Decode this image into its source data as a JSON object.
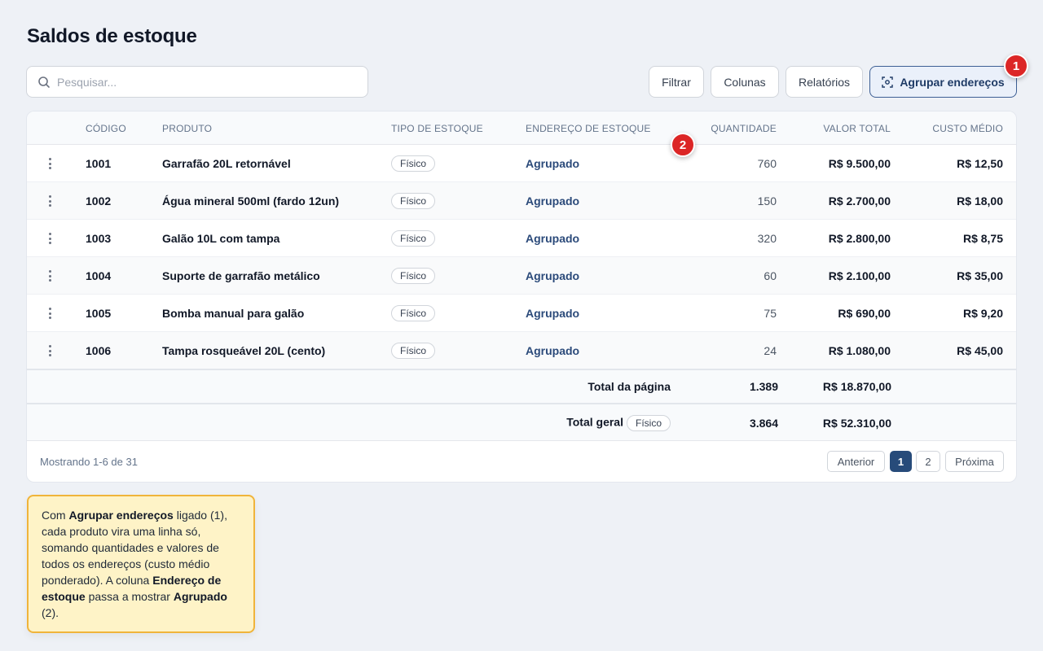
{
  "page": {
    "title": "Saldos de estoque"
  },
  "search": {
    "placeholder": "Pesquisar..."
  },
  "toolbar": {
    "filter_label": "Filtrar",
    "columns_label": "Colunas",
    "reports_label": "Relatórios",
    "group_label": "Agrupar endereços"
  },
  "markers": {
    "m1": "1",
    "m2": "2"
  },
  "table": {
    "headers": {
      "code": "CÓDIGO",
      "product": "PRODUTO",
      "stock_type": "TIPO DE ESTOQUE",
      "address": "ENDEREÇO DE ESTOQUE",
      "quantity": "QUANTIDADE",
      "total_value": "VALOR TOTAL",
      "avg_cost": "CUSTO MÉDIO"
    },
    "rows": [
      {
        "code": "1001",
        "product": "Garrafão 20L retornável",
        "type": "Físico",
        "address": "Agrupado",
        "qty": "760",
        "value": "R$ 9.500,00",
        "cost": "R$ 12,50"
      },
      {
        "code": "1002",
        "product": "Água mineral 500ml (fardo 12un)",
        "type": "Físico",
        "address": "Agrupado",
        "qty": "150",
        "value": "R$ 2.700,00",
        "cost": "R$ 18,00"
      },
      {
        "code": "1003",
        "product": "Galão 10L com tampa",
        "type": "Físico",
        "address": "Agrupado",
        "qty": "320",
        "value": "R$ 2.800,00",
        "cost": "R$ 8,75"
      },
      {
        "code": "1004",
        "product": "Suporte de garrafão metálico",
        "type": "Físico",
        "address": "Agrupado",
        "qty": "60",
        "value": "R$ 2.100,00",
        "cost": "R$ 35,00"
      },
      {
        "code": "1005",
        "product": "Bomba manual para galão",
        "type": "Físico",
        "address": "Agrupado",
        "qty": "75",
        "value": "R$ 690,00",
        "cost": "R$ 9,20"
      },
      {
        "code": "1006",
        "product": "Tampa rosqueável 20L (cento)",
        "type": "Físico",
        "address": "Agrupado",
        "qty": "24",
        "value": "R$ 1.080,00",
        "cost": "R$ 45,00"
      }
    ],
    "page_total": {
      "label": "Total da página",
      "qty": "1.389",
      "value": "R$ 18.870,00"
    },
    "grand_total": {
      "label": "Total geral",
      "type": "Físico",
      "qty": "3.864",
      "value": "R$ 52.310,00"
    }
  },
  "pagination": {
    "showing": "Mostrando 1-6 de 31",
    "prev": "Anterior",
    "page1": "1",
    "page2": "2",
    "next": "Próxima"
  },
  "note": {
    "t1": "Com ",
    "b1": "Agrupar endereços",
    "t2": " ligado (1), cada produto vira uma linha só, somando quantidades e valores de todos os endereços (custo médio ponderado). A coluna ",
    "b2": "Endereço de estoque",
    "t3": " passa a mostrar ",
    "b3": "Agrupado",
    "t4": " (2)."
  },
  "colors": {
    "accent": "#274b7a",
    "badge": "#dc2626",
    "note_bg": "#fef3c7",
    "note_border": "#f0b43a"
  },
  "icons": [
    "search-icon",
    "group-addresses-icon",
    "kebab-menu-icon"
  ]
}
